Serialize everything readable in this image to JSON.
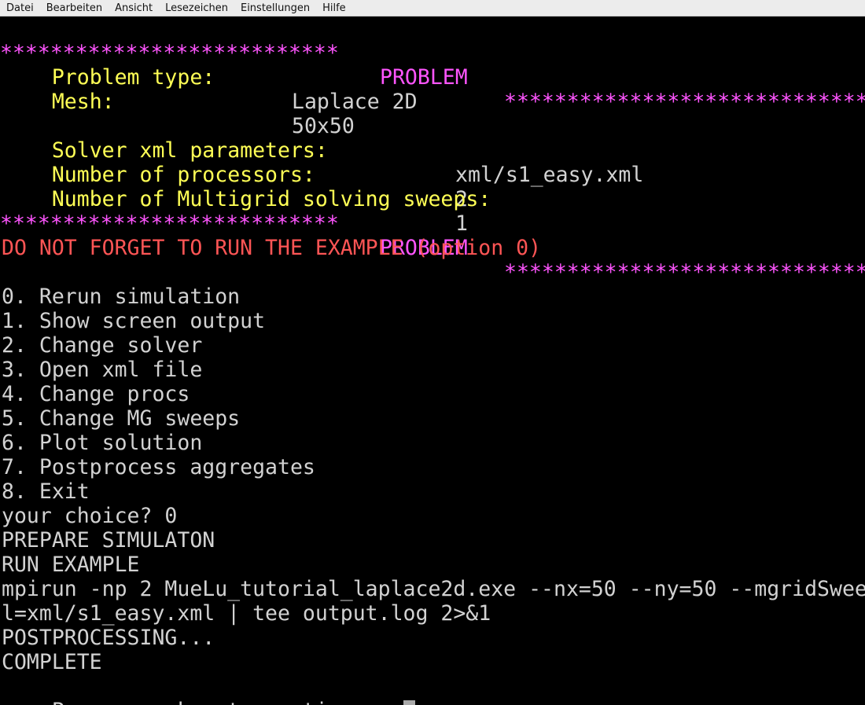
{
  "menubar": {
    "items": [
      "Datei",
      "Bearbeiten",
      "Ansicht",
      "Lesezeichen",
      "Einstellungen",
      "Hilfe"
    ]
  },
  "colors": {
    "background": "#000000",
    "magenta": "#ff55ff",
    "yellow": "#ffff55",
    "red": "#ff5555",
    "text": "#d2d2d2",
    "cursor": "#aaaaaa"
  },
  "terminal": {
    "banner": {
      "stars_left": "***************************",
      "title": "PROBLEM",
      "stars_right": "*****************************"
    },
    "problem_type_label": "Problem type:",
    "problem_type_value": "Laplace 2D",
    "mesh_label": "Mesh:",
    "mesh_value": "50x50",
    "solver_label": "Solver xml parameters:",
    "solver_value": "xml/s1_easy.xml",
    "procs_label": "Number of processors:",
    "procs_value": "2",
    "sweeps_label": "Number of Multigrid solving sweeps:",
    "sweeps_value": "1",
    "warning": "DO NOT FORGET TO RUN THE EXAMPLE (option 0)",
    "menu_options": [
      "0. Rerun simulation",
      "1. Show screen output",
      "2. Change solver",
      "3. Open xml file",
      "4. Change procs",
      "5. Change MG sweeps",
      "6. Plot solution",
      "7. Postprocess aggregates",
      "8. Exit"
    ],
    "prompt": "your choice? 0",
    "output_lines": [
      "PREPARE SIMULATON",
      "RUN EXAMPLE",
      "mpirun -np 2 MueLu_tutorial_laplace2d.exe --nx=50 --ny=50 --mgridSwee",
      "l=xml/s1_easy.xml | tee output.log 2>&1",
      "POSTPROCESSING...",
      "COMPLETE"
    ],
    "continue_prompt": "Press any key to continue..."
  }
}
